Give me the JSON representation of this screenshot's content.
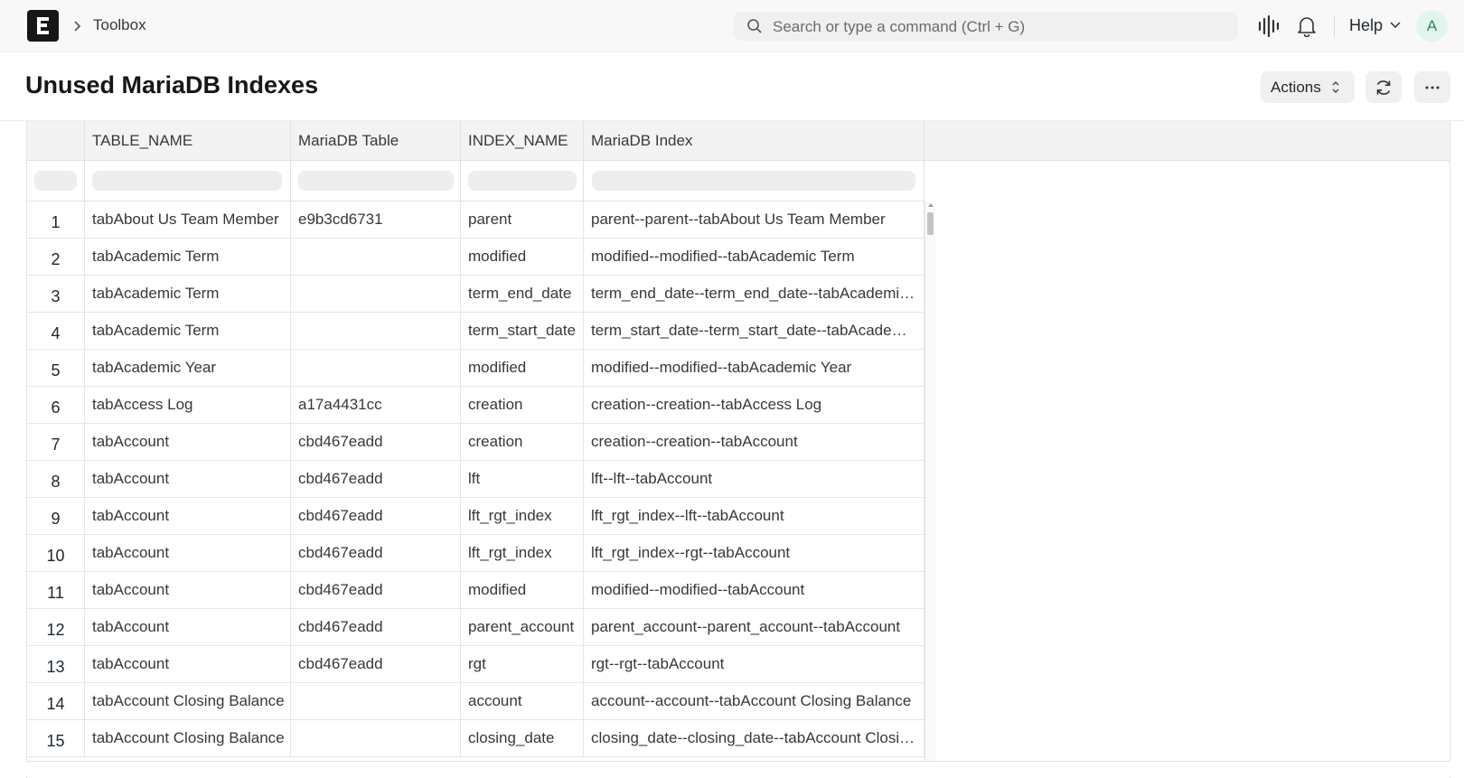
{
  "navbar": {
    "breadcrumb": "Toolbox",
    "search_placeholder": "Search or type a command (Ctrl + G)",
    "help_label": "Help",
    "avatar_initial": "A"
  },
  "page": {
    "title": "Unused MariaDB Indexes",
    "actions_label": "Actions"
  },
  "table": {
    "columns": [
      "TABLE_NAME",
      "MariaDB Table",
      "INDEX_NAME",
      "MariaDB Index"
    ],
    "rows": [
      {
        "n": "1",
        "table_name": "tabAbout Us Team Member",
        "mariadb_table": "e9b3cd6731",
        "index_name": "parent",
        "mariadb_index": "parent--parent--tabAbout Us Team Member"
      },
      {
        "n": "2",
        "table_name": "tabAcademic Term",
        "mariadb_table": "",
        "index_name": "modified",
        "mariadb_index": "modified--modified--tabAcademic Term"
      },
      {
        "n": "3",
        "table_name": "tabAcademic Term",
        "mariadb_table": "",
        "index_name": "term_end_date",
        "mariadb_index": "term_end_date--term_end_date--tabAcademic Term"
      },
      {
        "n": "4",
        "table_name": "tabAcademic Term",
        "mariadb_table": "",
        "index_name": "term_start_date",
        "mariadb_index": "term_start_date--term_start_date--tabAcademic Term"
      },
      {
        "n": "5",
        "table_name": "tabAcademic Year",
        "mariadb_table": "",
        "index_name": "modified",
        "mariadb_index": "modified--modified--tabAcademic Year"
      },
      {
        "n": "6",
        "table_name": "tabAccess Log",
        "mariadb_table": "a17a4431cc",
        "index_name": "creation",
        "mariadb_index": "creation--creation--tabAccess Log"
      },
      {
        "n": "7",
        "table_name": "tabAccount",
        "mariadb_table": "cbd467eadd",
        "index_name": "creation",
        "mariadb_index": "creation--creation--tabAccount"
      },
      {
        "n": "8",
        "table_name": "tabAccount",
        "mariadb_table": "cbd467eadd",
        "index_name": "lft",
        "mariadb_index": "lft--lft--tabAccount"
      },
      {
        "n": "9",
        "table_name": "tabAccount",
        "mariadb_table": "cbd467eadd",
        "index_name": "lft_rgt_index",
        "mariadb_index": "lft_rgt_index--lft--tabAccount"
      },
      {
        "n": "10",
        "table_name": "tabAccount",
        "mariadb_table": "cbd467eadd",
        "index_name": "lft_rgt_index",
        "mariadb_index": "lft_rgt_index--rgt--tabAccount"
      },
      {
        "n": "11",
        "table_name": "tabAccount",
        "mariadb_table": "cbd467eadd",
        "index_name": "modified",
        "mariadb_index": "modified--modified--tabAccount"
      },
      {
        "n": "12",
        "table_name": "tabAccount",
        "mariadb_table": "cbd467eadd",
        "index_name": "parent_account",
        "mariadb_index": "parent_account--parent_account--tabAccount"
      },
      {
        "n": "13",
        "table_name": "tabAccount",
        "mariadb_table": "cbd467eadd",
        "index_name": "rgt",
        "mariadb_index": "rgt--rgt--tabAccount"
      },
      {
        "n": "14",
        "table_name": "tabAccount Closing Balance",
        "mariadb_table": "",
        "index_name": "account",
        "mariadb_index": "account--account--tabAccount Closing Balance"
      },
      {
        "n": "15",
        "table_name": "tabAccount Closing Balance",
        "mariadb_table": "",
        "index_name": "closing_date",
        "mariadb_index": "closing_date--closing_date--tabAccount Closing Balance"
      }
    ]
  }
}
